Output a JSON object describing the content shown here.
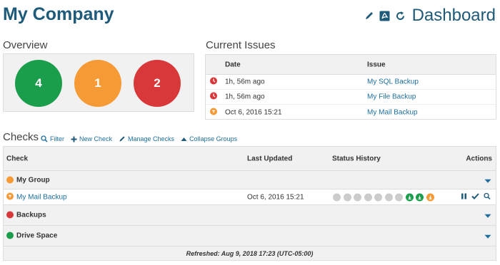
{
  "header": {
    "company": "My Company",
    "dashboard_label": "Dashboard"
  },
  "overview": {
    "title": "Overview",
    "circles": [
      {
        "value": "4",
        "color": "#1a9e4b",
        "status": "ok"
      },
      {
        "value": "1",
        "color": "#f59a34",
        "status": "warning"
      },
      {
        "value": "2",
        "color": "#d9383a",
        "status": "error"
      }
    ]
  },
  "issues": {
    "title": "Current Issues",
    "columns": {
      "date": "Date",
      "issue": "Issue"
    },
    "rows": [
      {
        "icon": "clock-error-icon",
        "color": "#d9383a",
        "date": "1h, 56m ago",
        "issue": "My SQL Backup"
      },
      {
        "icon": "clock-error-icon",
        "color": "#d9383a",
        "date": "1h, 56m ago",
        "issue": "My File Backup"
      },
      {
        "icon": "warning-icon",
        "color": "#f59a34",
        "date": "Oct 6, 2016 15:21",
        "issue": "My Mail Backup"
      }
    ]
  },
  "checks": {
    "title": "Checks",
    "actions": {
      "filter": "Filter",
      "new_check": "New Check",
      "manage": "Manage Checks",
      "collapse": "Collapse Groups"
    },
    "columns": {
      "check": "Check",
      "last_updated": "Last Updated",
      "status_history": "Status History",
      "actions": "Actions"
    },
    "groups": [
      {
        "name": "My Group",
        "color": "#f59a34"
      },
      {
        "name": "Backups",
        "color": "#d9383a"
      },
      {
        "name": "Drive Space",
        "color": "#1a9e4b"
      }
    ],
    "check_row": {
      "name": "My Mail Backup",
      "last_updated": "Oct 6, 2016 15:21",
      "history": [
        "#cccccc",
        "#cccccc",
        "#cccccc",
        "#cccccc",
        "#cccccc",
        "#cccccc",
        "#cccccc",
        "#1a9e4b",
        "#1a9e4b",
        "#f59a34"
      ]
    },
    "refreshed": "Refreshed: Aug 9, 2018 17:23 (UTC-05:00)"
  },
  "colors": {
    "brand": "#1e5a7a",
    "link": "#1e6f9f",
    "ok": "#1a9e4b",
    "warning": "#f59a34",
    "error": "#d9383a"
  }
}
